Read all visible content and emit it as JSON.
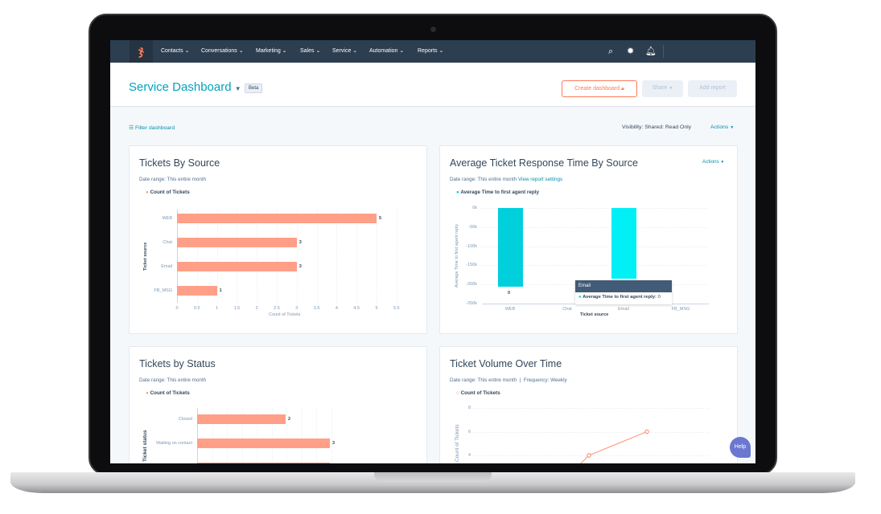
{
  "nav": {
    "items": [
      "Contacts",
      "Conversations",
      "Marketing",
      "Sales",
      "Service",
      "Automation",
      "Reports"
    ],
    "icons": [
      "search-icon",
      "gear-icon",
      "bell-icon"
    ]
  },
  "header": {
    "title": "Service Dashboard",
    "badge": "Beta",
    "create_label": "Create dashboard",
    "share_label": "Share",
    "add_report_label": "Add report"
  },
  "toolbar": {
    "filter_label": "Filter dashboard",
    "visibility": "Visibility:  Shared: Read Only",
    "actions_label": "Actions"
  },
  "colors": {
    "accent": "#00a4bd",
    "nav": "#2d3e50",
    "bar": "#ff9f87",
    "teal": "#00d0e4",
    "help": "#6a78d1"
  },
  "help_label": "Help",
  "cards": [
    {
      "title": "Tickets By Source",
      "date_range": "Date range: This entire month"
    },
    {
      "title": "Average Ticket Response Time By Source",
      "date_range": "Date range: This entire month",
      "link": "View report settings",
      "actions": "Actions"
    },
    {
      "title": "Tickets by Status",
      "date_range": "Date range: This entire month"
    },
    {
      "title": "Ticket Volume Over Time",
      "date_range": "Date range: This entire month",
      "frequency": "Frequency: Weekly"
    }
  ],
  "chart_data": [
    {
      "type": "bar",
      "orientation": "horizontal",
      "legend": "Count of Tickets",
      "categories": [
        "WEB",
        "Chat",
        "Email",
        "FB_MSG"
      ],
      "values": [
        5,
        3,
        3,
        1
      ],
      "xlabel": "Count of Tickets",
      "ylabel": "Ticket source",
      "xlim": [
        0,
        5.5
      ],
      "xticks": [
        "0",
        "0.5",
        "1",
        "1.5",
        "2",
        "2.5",
        "3",
        "3.5",
        "4",
        "4.5",
        "5",
        "5.5"
      ]
    },
    {
      "type": "bar",
      "legend": "Average Time to first agent reply",
      "categories": [
        "WEB",
        "Chat",
        "Email",
        "FB_MSG"
      ],
      "values": [
        -205000,
        null,
        -185000,
        null
      ],
      "data_labels": [
        "0",
        "",
        "",
        ""
      ],
      "xlabel": "Ticket source",
      "ylabel": "Average Time to first agent reply",
      "ylim": [
        -250000,
        0
      ],
      "yticks": [
        "0k",
        "-50k",
        "-100k",
        "-150k",
        "-200k",
        "-250k"
      ],
      "tooltip": {
        "title": "Email",
        "label": "Average Time to first agent reply:",
        "value": "0"
      }
    },
    {
      "type": "bar",
      "orientation": "horizontal",
      "legend": "Count of Tickets",
      "categories": [
        "Closed",
        "Waiting on contact",
        ""
      ],
      "values": [
        2,
        3,
        3
      ],
      "ylabel": "Ticket status"
    },
    {
      "type": "line",
      "legend": "Count of Tickets",
      "ylabel": "Count of Tickets",
      "yticks": [
        "8",
        "6",
        "4"
      ],
      "values": [
        4,
        6
      ]
    }
  ]
}
